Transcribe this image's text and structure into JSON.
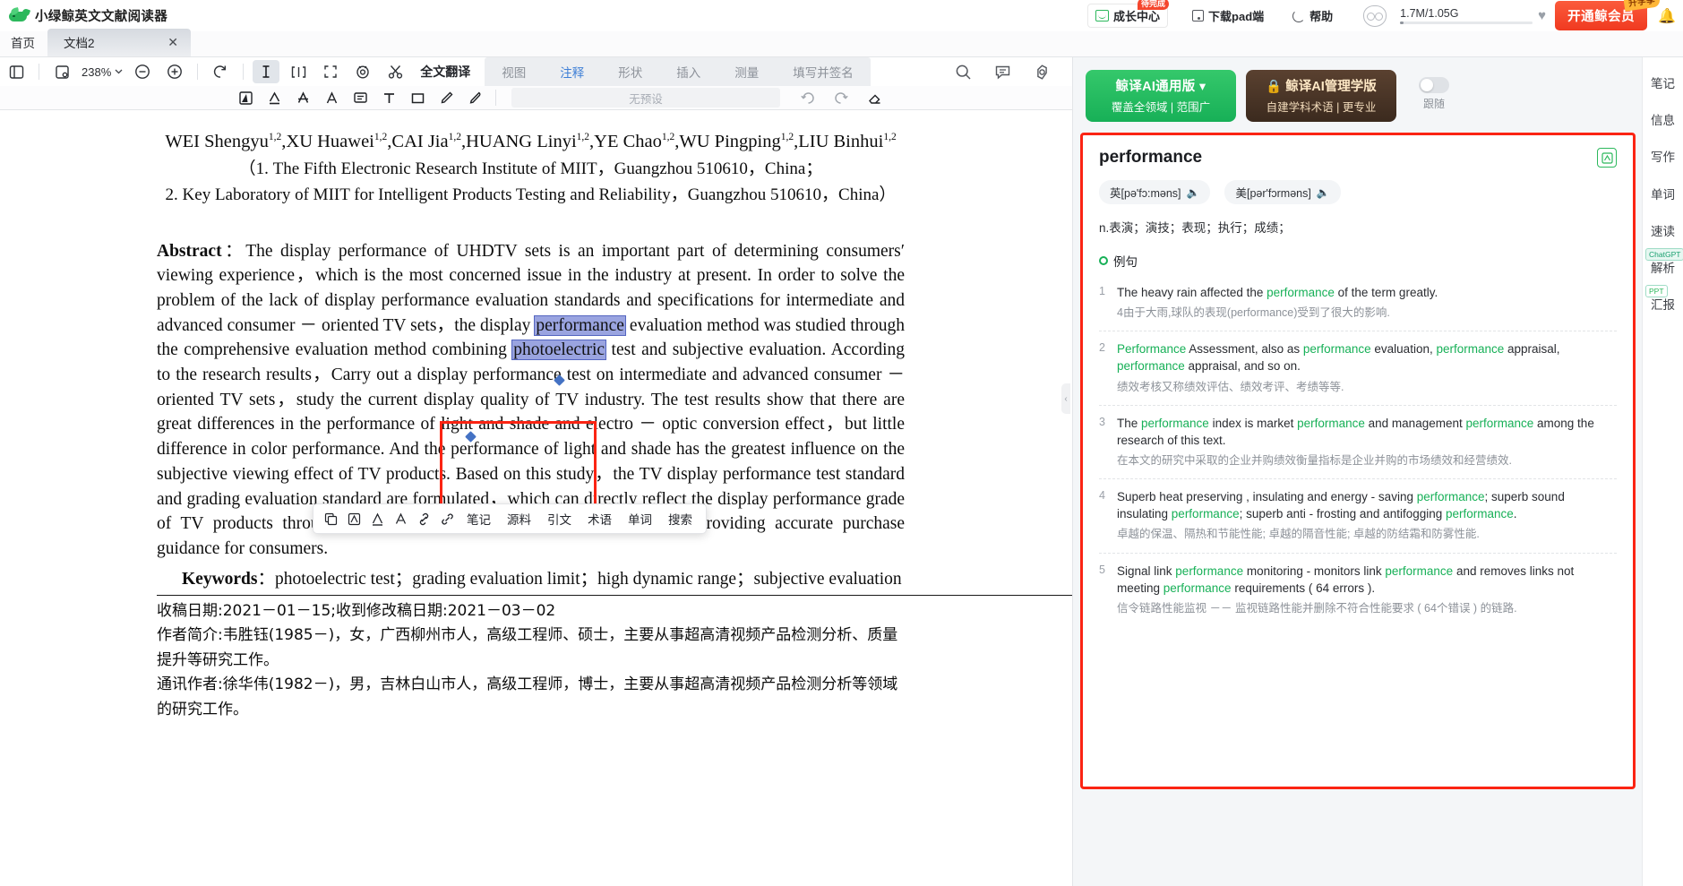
{
  "app": {
    "brand_title": "小绿鲸英文文献阅读器",
    "logo_icon": "whale-logo"
  },
  "header": {
    "growth_center": {
      "label": "成长中心",
      "badge": "待完成",
      "icon": "growth-chart-icon"
    },
    "download_pad": {
      "label": "下载pad端",
      "icon": "tablet-icon"
    },
    "help": {
      "label": "帮助",
      "icon": "help-circle-icon"
    },
    "avatar_icon": "owl-avatar-icon",
    "storage": "1.7M/1.05G",
    "favorite_icon": "heart-icon",
    "vip_button": {
      "label": "开通鲸会员",
      "badge": "升学季"
    },
    "bell_icon": "bell-icon"
  },
  "tabs": {
    "home_label": "首页",
    "doc_label": "文档2",
    "close_icon": "close-icon"
  },
  "toolbar": {
    "zoom_level": "238%",
    "fulltext_translate": "全文翻译",
    "ribbon_tabs": [
      {
        "label": "视图",
        "active": false
      },
      {
        "label": "注释",
        "active": true
      },
      {
        "label": "形状",
        "active": false
      },
      {
        "label": "插入",
        "active": false
      },
      {
        "label": "测量",
        "active": false
      },
      {
        "label": "填写并签名",
        "active": false
      }
    ],
    "icons_row1": [
      "sidebar-toggle-icon",
      "thumbnail-icon",
      "zoom-out-icon",
      "zoom-in-icon",
      "rotate-icon",
      "text-select-icon",
      "split-view-icon",
      "fullscreen-icon",
      "eye-icon",
      "scissors-icon"
    ],
    "icons_row2": [
      "highlight-square-icon",
      "underline-text-icon",
      "strikethrough-text-icon",
      "text-color-icon",
      "comment-icon",
      "text-tool-icon",
      "rectangle-icon",
      "pen-icon",
      "brush-icon"
    ],
    "preset_placeholder": "无预设",
    "undo_icon": "undo-icon",
    "redo_icon": "redo-icon",
    "eraser_icon": "eraser-icon",
    "search_icon": "search-icon",
    "comment_panel_icon": "comment-panel-icon",
    "settings_icon": "settings-gear-icon"
  },
  "document": {
    "authors": "WEI Shengyu ,XU Huawei ,CAI Jia ,HUANG Linyi ,YE Chao ,WU Pingping ,LIU Binhui",
    "author_list": [
      {
        "name": "WEI Shengyu",
        "sup": "1,2"
      },
      {
        "name": "XU Huawei",
        "sup": "1,2"
      },
      {
        "name": "CAI Jia",
        "sup": "1,2"
      },
      {
        "name": "HUANG Linyi",
        "sup": "1,2"
      },
      {
        "name": "YE Chao",
        "sup": "1,2"
      },
      {
        "name": "WU Pingping",
        "sup": "1,2"
      },
      {
        "name": "LIU Binhui",
        "sup": "1,2"
      }
    ],
    "affiliation_1": "（1. The Fifth Electronic Research Institute of MIIT，Guangzhou 510610，China；",
    "affiliation_2": "2. Key Laboratory of MIIT for Intelligent Products Testing and Reliability，Guangzhou 510610，China）",
    "abstract_label": "Abstract",
    "abstract_p1": "：The display performance of UHDTV sets is an important part of determining consumers′ viewing experience，which is the most concerned issue in the industry at present. In order to solve the problem of the lack of display performance evaluation standards and specifications for intermediate and advanced consumer － oriented TV sets，the display ",
    "abstract_selected": "performance",
    "abstract_p2": " evaluation method was studied through the comprehensive evaluation method combining ",
    "abstract_selected2": "photoelectric",
    "abstract_p3": " test and subjective evaluation. According to the research results，Carry out a display performance test on intermediate and advanced consumer － oriented TV sets，study the current display quality of TV industry. The test results show that there are great differences in the performance of light and shade and electro － optic conversion effect，but little difference in color performance. And the performance of light and shade has the greatest influence on the subjective viewing effect of TV products. Based on this study，the TV display performance test standard and grading evaluation standard are formulated，which can directly reflect the display performance grade of TV products through the efficient photoelectric test method，thus providing accurate purchase guidance for consumers.",
    "keywords_label": "Keywords",
    "keywords_value": "：photoelectric test；grading evaluation limit；high dynamic range；subjective evaluation",
    "received_date": "收稿日期:2021－01－15;收到修改稿日期:2021－03－02",
    "author_bio": "作者简介:韦胜钰(1985－)，女，广西柳州市人，高级工程师、硕士，主要从事超高清视频产品检测分析、质量提升等研究工作。",
    "corresponding_author": "通讯作者:徐华伟(1982－)，男，吉林白山市人，高级工程师，博士，主要从事超高清视频产品检测分析等领域的研究工作。"
  },
  "context_menu": {
    "icons": [
      "copy-icon",
      "translate-icon",
      "highlight-icon",
      "underline-icon",
      "search-web-icon",
      "link-icon"
    ],
    "items": [
      "笔记",
      "源料",
      "引文",
      "术语",
      "单词",
      "搜索"
    ]
  },
  "right_panel": {
    "general_button": {
      "line1": "鲸译AI通用版",
      "line2": "覆盖全领域 | 范围广",
      "caret_icon": "chevron-down-icon"
    },
    "management_button": {
      "line1": "鲸译AI管理学版",
      "line2": "自建学科术语 | 更专业",
      "lock_icon": "lock-icon"
    },
    "follow_toggle": {
      "label": "跟随",
      "state": "off"
    },
    "word_card": {
      "word": "performance",
      "add_icon": "add-to-wordbook-icon",
      "phonetic_uk": {
        "prefix": "英",
        "value": "[pə'fɔ:məns]",
        "speaker_icon": "speaker-icon"
      },
      "phonetic_us": {
        "prefix": "美",
        "value": "[pər'fɔrməns]",
        "speaker_icon": "speaker-icon"
      },
      "definitions": "n.表演；演技；表现；执行；成绩；",
      "examples_title": "例句",
      "examples": [
        {
          "num": "1",
          "en_parts": [
            "The heavy rain affected the ",
            "performance",
            " of the term greatly."
          ],
          "cn": "4由于大雨,球队的表现(performance)受到了很大的影响."
        },
        {
          "num": "2",
          "en_parts": [
            "",
            "Performance",
            " Assessment, also as ",
            "performance",
            " evaluation, ",
            "performance",
            " appraisal, ",
            "performance",
            " appraisal, and so on."
          ],
          "cn": "绩效考核又称绩效评估、绩效考评、考绩等等."
        },
        {
          "num": "3",
          "en_parts": [
            "The ",
            "performance",
            " index is market ",
            "performance",
            " and management ",
            "performance",
            " among the research of this text."
          ],
          "cn": "在本文的研究中采取的企业并购绩效衡量指标是企业并购的市场绩效和经营绩效."
        },
        {
          "num": "4",
          "en_parts": [
            "Superb heat preserving , insulating and energy - saving ",
            "performance",
            "; superb sound insulating ",
            "performance",
            "; superb anti - frosting and antifogging ",
            "performance",
            "."
          ],
          "cn": "卓越的保温、隔热和节能性能; 卓越的隔音性能; 卓越的防结霜和防雾性能."
        },
        {
          "num": "5",
          "en_parts": [
            "Signal link ",
            "performance",
            " monitoring - monitors link ",
            "performance",
            " and removes links not meeting ",
            "performance",
            " requirements ( 64 errors )."
          ],
          "cn": "信令链路性能监视 －－ 监视链路性能并删除不符合性能要求 ( 64个错误 ) 的链路."
        }
      ]
    }
  },
  "rail": [
    {
      "label": "笔记",
      "badge": null
    },
    {
      "label": "信息",
      "badge": null
    },
    {
      "label": "写作",
      "badge": null
    },
    {
      "label": "单词",
      "badge": null
    },
    {
      "label": "速读",
      "badge": null
    },
    {
      "label": "解析",
      "badge": "ChatGPT"
    },
    {
      "label": "汇报",
      "badge": "PPT"
    }
  ],
  "colors": {
    "accent_green": "#2cb85c",
    "accent_blue": "#3e7fd6",
    "alert_red": "#fb2413",
    "vip_red": "#f03a20",
    "selection": "#9aa4e0"
  }
}
